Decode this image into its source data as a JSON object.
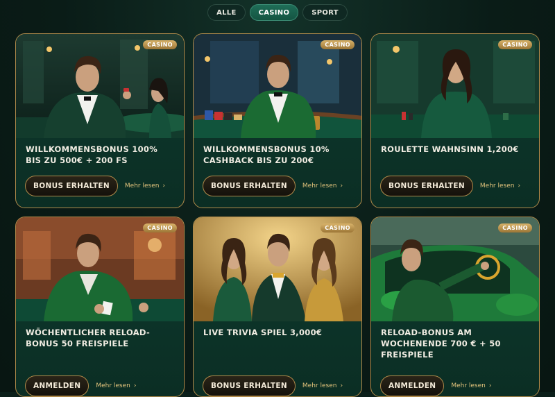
{
  "filters": [
    {
      "label": "ALLE",
      "active": false
    },
    {
      "label": "CASINO",
      "active": true
    },
    {
      "label": "SPORT",
      "active": false
    }
  ],
  "colors": {
    "accent": "#1f6e58",
    "gold": "#b08a4a",
    "card_bg": "#0e3a2e"
  },
  "cards": [
    {
      "badge": "CASINO",
      "title": "WILLKOMMENSBONUS 100% BIS ZU 500€ + 200 FS",
      "cta": "BONUS ERHALTEN",
      "more": "Mehr lesen",
      "image": "man-in-green-velvet-jacket-casino-table"
    },
    {
      "badge": "CASINO",
      "title": "WILLKOMMENSBONUS 10% CASHBACK BIS ZU 200€",
      "cta": "BONUS ERHALTEN",
      "more": "Mehr lesen",
      "image": "man-in-green-suit-poker-chips"
    },
    {
      "badge": "CASINO",
      "title": "ROULETTE WAHNSINN 1,200€",
      "cta": "BONUS ERHALTEN",
      "more": "Mehr lesen",
      "image": "woman-in-green-dress-cards"
    },
    {
      "badge": "CASINO",
      "title": "WÖCHENTLICHER RELOAD-BONUS 50 FREISPIELE",
      "cta": "ANMELDEN",
      "more": "Mehr lesen",
      "image": "man-playing-cards-casino-hall"
    },
    {
      "badge": "CASINO",
      "title": "LIVE TRIVIA SPIEL 3,000€",
      "cta": "BONUS ERHALTEN",
      "more": "Mehr lesen",
      "image": "man-between-two-women-gold"
    },
    {
      "badge": "CASINO",
      "title": "RELOAD-BONUS AM WOCHENENDE 700 € + 50 FREISPIELE",
      "cta": "ANMELDEN",
      "more": "Mehr lesen",
      "image": "man-in-green-sports-car"
    }
  ]
}
